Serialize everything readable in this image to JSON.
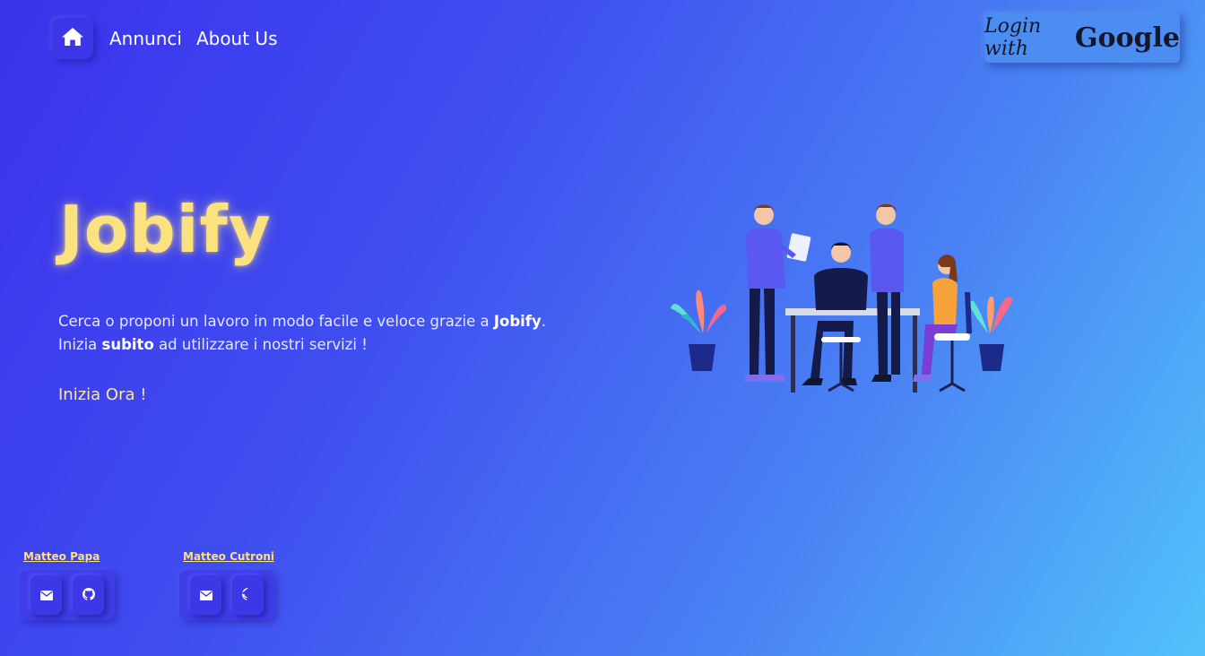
{
  "nav": {
    "home_icon": "home-icon",
    "links": [
      "Annunci",
      "About Us"
    ]
  },
  "login": {
    "label": "Login with",
    "brand": "Google"
  },
  "hero": {
    "logo": "Jobify",
    "desc_line1_prefix": "Cerca o proponi un lavoro in modo facile e veloce grazie a ",
    "desc_line1_bold": "Jobify",
    "desc_line1_suffix": ".",
    "desc_line2_prefix": "Inizia ",
    "desc_line2_bold": "subito",
    "desc_line2_suffix": " ad utilizzare i nostri servizi !",
    "cta": "Inizia Ora !"
  },
  "footer": {
    "authors": [
      {
        "name": "Matteo Papa",
        "icons": [
          "envelope-icon",
          "github-icon"
        ]
      },
      {
        "name": "Matteo Cutroni",
        "icons": [
          "envelope-icon",
          "github-icon"
        ]
      }
    ]
  },
  "colors": {
    "accent_yellow": "#fbe27e",
    "bg_start": "#3b32ec",
    "bg_end": "#52c2fb"
  }
}
